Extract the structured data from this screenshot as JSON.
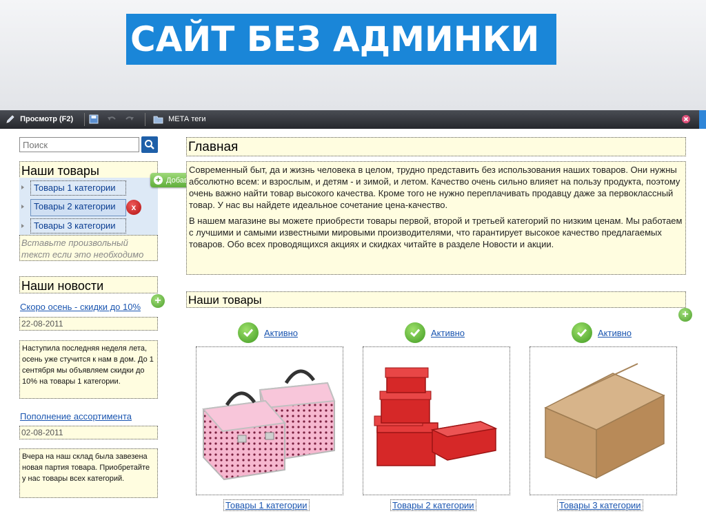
{
  "banner": {
    "title": "САЙТ БЕЗ АДМИНКИ"
  },
  "toolbar": {
    "preview_label": "Просмотр (F2)",
    "meta_label": "МЕТА теги"
  },
  "search": {
    "placeholder": "Поиск"
  },
  "sidebar": {
    "products_heading": "Наши товары",
    "categories": [
      {
        "label": "Товары 1 категории"
      },
      {
        "label": "Товары 2 категории"
      },
      {
        "label": "Товары 3 категории"
      }
    ],
    "add_page_label": "Добавить страницу",
    "delete_label": "x",
    "placeholder_note": "Вставьте произвольный текст если это необходимо",
    "news_heading": "Наши новости",
    "news": [
      {
        "title": "Скоро осень - скидки до 10%",
        "date": "22-08-2011",
        "text": "Наступила последняя неделя лета, осень уже стучится к нам в дом. До 1 сентября мы объявляем скидки до 10% на товары 1 категории."
      },
      {
        "title": "Пополнение ассортимента",
        "date": "02-08-2011",
        "text": "Вчера на наш склад была завезена новая партия товара. Приобретайте у нас товары всех категорий."
      }
    ]
  },
  "main": {
    "page_heading": "Главная",
    "paragraphs": [
      "Современный быт, да и жизнь человека в целом, трудно представить без использования наших товаров. Они нужны абсолютно всем: и взрослым, и детям - и зимой, и летом. Качество очень сильно влияет на пользу продукта, поэтому очень важно найти товар высокого качества. Кроме того не нужно переплачивать продавцу даже за первоклассный товар. У нас вы найдете идеальное сочетание цена-качество.",
      "В нашем магазине вы можете приобрести товары первой, второй и третьей категорий по низким ценам. Мы работаем с лучшими и самыми известными мировыми производителями, что гарантирует высокое качество предлагаемых товаров. Обо всех проводящихся акциях и скидках читайте в разделе Новости и акции."
    ],
    "products_heading": "Наши товары",
    "products": [
      {
        "status": "Активно",
        "link": "Товары 1 категории",
        "image": "pink-cosmetic-cases"
      },
      {
        "status": "Активно",
        "link": "Товары 2 категории",
        "image": "red-gift-boxes"
      },
      {
        "status": "Активно",
        "link": "Товары 3 категории",
        "image": "cardboard-box"
      }
    ]
  },
  "colors": {
    "banner_blue": "#1a86d8",
    "editable_bg": "#fffde0",
    "link_blue": "#1a55b0",
    "active_green": "#4c9e2a",
    "delete_red": "#c01818"
  }
}
